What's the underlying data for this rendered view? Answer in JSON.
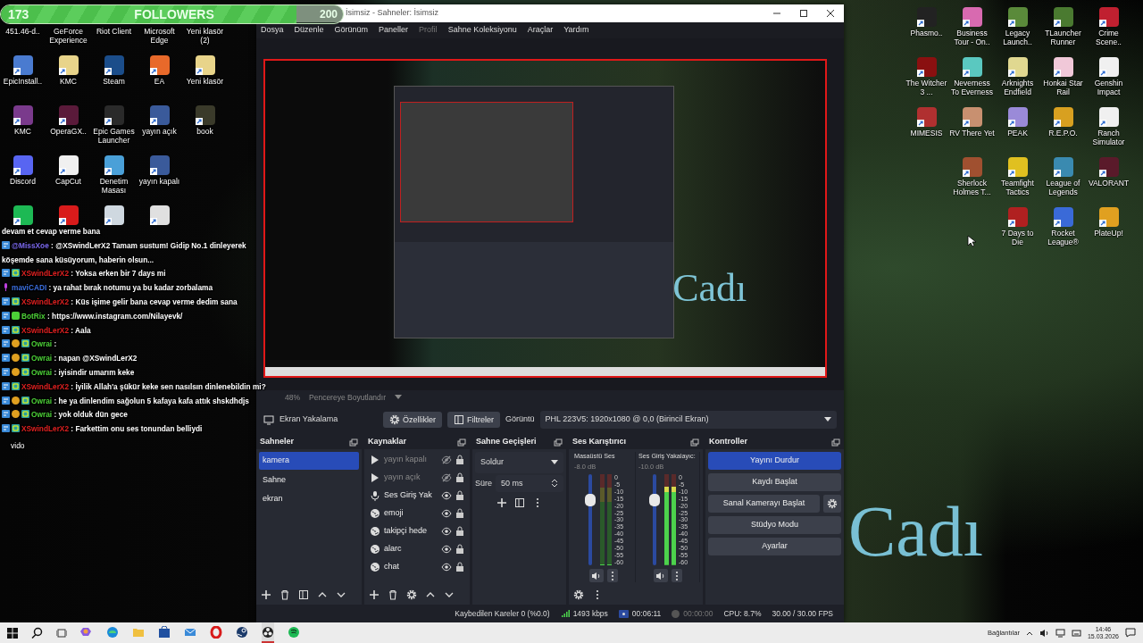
{
  "followers": {
    "count": "173",
    "label": "FOLLOWERS",
    "goal": "200",
    "level": 0.865
  },
  "desktop_left": {
    "rows": [
      {
        "icons": [
          {
            "label": "451.46-d.."
          },
          {
            "label": "GeForce Experience"
          },
          {
            "label": "Riot Client"
          },
          {
            "label": "Microsoft Edge"
          },
          {
            "label": "Yeni klasör (2)"
          }
        ]
      },
      {
        "icons": [
          {
            "label": "EpicInstall..",
            "color": "#4a7bd0"
          },
          {
            "label": "KMC",
            "color": "#e8d48a"
          },
          {
            "label": "Steam",
            "color": "#1b4d8a"
          },
          {
            "label": "EA",
            "color": "#e8692a"
          },
          {
            "label": "Yeni klasör",
            "color": "#e8d48a"
          }
        ]
      },
      {
        "icons": [
          {
            "label": "KMC",
            "color": "#7a3a8c"
          },
          {
            "label": "OperaGX..",
            "color": "#5a1a3a"
          },
          {
            "label": "Epic Games Launcher",
            "color": "#2a2a2a"
          },
          {
            "label": "yayın açık",
            "color": "#3a5a9a"
          },
          {
            "label": "book",
            "color": "#3a3a2a"
          }
        ]
      },
      {
        "icons": [
          {
            "label": "Discord",
            "color": "#5865f2"
          },
          {
            "label": "CapCut",
            "color": "#f0f0f0"
          },
          {
            "label": "Denetim Masası",
            "color": "#4aa0d8"
          },
          {
            "label": "yayın kapalı",
            "color": "#3a5a9a"
          }
        ]
      },
      {
        "icons": [
          {
            "color": "#1db954"
          },
          {
            "color": "#d81b1b"
          },
          {
            "color": "#cfd8e0"
          },
          {
            "color": "#e0e0e0"
          }
        ]
      }
    ],
    "stray_label": "vido"
  },
  "chat": [
    {
      "text": "devam et cevap verme bana"
    },
    {
      "kind": "basic",
      "user": "@MissXoe",
      "color": "#7b68ee",
      "text": ": @XSwindLerX2 Tamam sustum! Gidip No.1 dinleyerek köşemde sana küsüyorum, haberin olsun..."
    },
    {
      "kind": "sub",
      "user": "XSwindLerX2",
      "color": "#e02020",
      "text": ": Yoksa erken bir 7 days mi"
    },
    {
      "kind": "streamer",
      "user": "maviCADI",
      "color": "#3b6fe0",
      "text": ": ya rahat bırak notumu ya bu kadar zorbalama"
    },
    {
      "kind": "sub",
      "user": "XSwindLerX2",
      "color": "#e02020",
      "text": ": Küs işime gelir bana cevap verme dedim sana"
    },
    {
      "kind": "bot",
      "user": "BotRix",
      "color": "#4cd137",
      "text": ": https://www.instagram.com/Nilayevk/"
    },
    {
      "kind": "sub",
      "user": "XSwindLerX2",
      "color": "#e02020",
      "text": ": Aala"
    },
    {
      "kind": "vip",
      "user": "Owrai",
      "color": "#4cd137",
      "text": ":"
    },
    {
      "kind": "vip",
      "user": "Owrai",
      "color": "#4cd137",
      "text": ": napan @XSwindLerX2"
    },
    {
      "kind": "vip",
      "user": "Owrai",
      "color": "#4cd137",
      "text": ": iyisindir umarım keke"
    },
    {
      "kind": "sub",
      "user": "XSwindLerX2",
      "color": "#e02020",
      "text": ": İyilik Allah'a şükür keke sen nasılsın dinlenebildin mi?"
    },
    {
      "kind": "vip",
      "user": "Owrai",
      "color": "#4cd137",
      "text": ": he ya dinlendim sağolun 5 kafaya kafa attık shskdhdjs"
    },
    {
      "kind": "vip",
      "user": "Owrai",
      "color": "#4cd137",
      "text": ": yok olduk dün gece"
    },
    {
      "kind": "sub",
      "user": "XSwindLerX2",
      "color": "#e02020",
      "text": ": Farkettim onu ses tonundan belliydi"
    }
  ],
  "obs": {
    "title": "İsimsiz - Sahneler: İsimsiz",
    "menu": [
      {
        "label": "Dosya",
        "disabled": false
      },
      {
        "label": "Düzenle",
        "disabled": false
      },
      {
        "label": "Görünüm",
        "disabled": false
      },
      {
        "label": "Paneller",
        "disabled": false
      },
      {
        "label": "Profil",
        "disabled": true
      },
      {
        "label": "Sahne Koleksiyonu",
        "disabled": false
      },
      {
        "label": "Araçlar",
        "disabled": false
      },
      {
        "label": "Yardım",
        "disabled": false
      }
    ],
    "preview_text": "Cadı",
    "zoom": "48%",
    "scale_mode": "Pencereye Boyutlandır",
    "source_toolbar": {
      "source": "Ekran Yakalama",
      "properties": "Özellikler",
      "filters": "Filtreler",
      "display_label": "Görüntü",
      "display_value": "PHL 223V5: 1920x1080 @ 0,0 (Birincil Ekran)"
    },
    "scenes": {
      "title": "Sahneler",
      "items": [
        {
          "label": "kamera",
          "selected": true
        },
        {
          "label": "Sahne",
          "selected": false
        },
        {
          "label": "ekran",
          "selected": false
        }
      ]
    },
    "sources": {
      "title": "Kaynaklar",
      "items": [
        {
          "kind": "media",
          "label": "yayın kapalı",
          "visible": false,
          "locked": true
        },
        {
          "kind": "media",
          "label": "yayın açık",
          "visible": false,
          "locked": true
        },
        {
          "kind": "audio",
          "label": "Ses Giriş Yak",
          "visible": true,
          "locked": true
        },
        {
          "kind": "browser",
          "label": "emoji",
          "visible": true,
          "locked": true
        },
        {
          "kind": "browser",
          "label": "takipçi hede",
          "visible": true,
          "locked": true
        },
        {
          "kind": "browser",
          "label": "alarc",
          "visible": true,
          "locked": true
        },
        {
          "kind": "browser",
          "label": "chat",
          "visible": true,
          "locked": true
        }
      ]
    },
    "transitions": {
      "title": "Sahne Geçişleri",
      "type": "Soldur",
      "duration_label": "Süre",
      "duration": "50 ms"
    },
    "mixer": {
      "title": "Ses Karıştırıcı",
      "channels": [
        {
          "name": "Masaüstü Ses",
          "db": "-8.0 dB",
          "level": 0.72,
          "meter": {
            "level": 0
          },
          "ticks": [
            "0",
            "-5",
            "-10",
            "-15",
            "-20",
            "-25",
            "-30",
            "-35",
            "-40",
            "-45",
            "-50",
            "-55",
            "-60"
          ]
        },
        {
          "name": "Ses Giriş Yakalayıc:",
          "db": "-10.0 dB",
          "level": 0.72,
          "meter": {
            "level": 0.85
          },
          "ticks": [
            "0",
            "-5",
            "-10",
            "-15",
            "-20",
            "-25",
            "-30",
            "-35",
            "-40",
            "-45",
            "-50",
            "-55",
            "-60"
          ]
        }
      ]
    },
    "controls": {
      "title": "Kontroller",
      "buttons": [
        {
          "label": "Yayını Durdur",
          "active": true,
          "has_settings": false
        },
        {
          "label": "Kaydı Başlat",
          "active": false,
          "has_settings": false
        },
        {
          "label": "Sanal Kamerayı Başlat",
          "active": false,
          "has_settings": true
        },
        {
          "label": "Stüdyo Modu",
          "active": false,
          "has_settings": false
        },
        {
          "label": "Ayarlar",
          "active": false,
          "has_settings": false
        }
      ]
    },
    "status": {
      "dropped": "Kaybedilen Kareler 0 (%0.0)",
      "bitrate": "1493 kbps",
      "live_time": "00:06:11",
      "live": true,
      "rec_time": "00:00:00",
      "recording": false,
      "cpu": "CPU: 8.7%",
      "fps": "30.00 / 30.00 FPS"
    }
  },
  "wallpaper_text": "Cadı",
  "desktop_right": {
    "rows": [
      {
        "icons": [
          {
            "label": "Phasmo..",
            "color": "#222222"
          },
          {
            "label": "Business Tour - On..",
            "color": "#d86ab0"
          },
          {
            "label": "Legacy Launch..",
            "color": "#5a8a3a"
          },
          {
            "label": "TLauncher Runner",
            "color": "#4a7a30"
          },
          {
            "label": "Crime Scene..",
            "color": "#c02030"
          }
        ]
      },
      {
        "icons": [
          {
            "label": "The Witcher 3 ...",
            "color": "#8a1010"
          },
          {
            "label": "Neverness To Everness",
            "color": "#5ac8c0"
          },
          {
            "label": "Arknights Endfield",
            "color": "#e0d890"
          },
          {
            "label": "Honkai Star Rail",
            "color": "#f0c8d8"
          },
          {
            "label": "Genshin Impact",
            "color": "#f0f0f0"
          }
        ]
      },
      {
        "icons": [
          {
            "label": "MIMESIS",
            "color": "#b03030"
          },
          {
            "label": "RV There Yet",
            "color": "#c89070"
          },
          {
            "label": "PEAK",
            "color": "#9a8ad8"
          },
          {
            "label": "R.E.P.O.",
            "color": "#d8a020"
          },
          {
            "label": "Ranch Simulator",
            "color": "#f0f0f0"
          }
        ]
      },
      {
        "icons": [
          {
            "label": "Sherlock Holmes T...",
            "color": "#a05030"
          },
          {
            "label": "Teamfight Tactics",
            "color": "#e0c020"
          },
          {
            "label": "League of Legends",
            "color": "#3a8ab0"
          },
          {
            "label": "VALORANT",
            "color": "#5a1a2a"
          }
        ]
      },
      {
        "icons": [
          {
            "label": "7 Days to Die",
            "color": "#b02020"
          },
          {
            "label": "Rocket League®",
            "color": "#3a6ad8"
          },
          {
            "label": "PlateUp!",
            "color": "#e0a020"
          }
        ]
      }
    ]
  },
  "taskbar": {
    "apps": [
      {
        "kind": "copilot",
        "active": false
      },
      {
        "kind": "edge",
        "active": false
      },
      {
        "kind": "folder",
        "active": false
      },
      {
        "kind": "store",
        "active": false
      },
      {
        "kind": "mailbox",
        "active": false
      },
      {
        "kind": "ring",
        "active": false
      },
      {
        "kind": "steam",
        "active": false
      },
      {
        "kind": "obs",
        "active": true
      },
      {
        "kind": "spotify",
        "active": false
      }
    ],
    "tray_label": "Bağlantılar",
    "time": "14:46",
    "date": "15.03.2026"
  }
}
